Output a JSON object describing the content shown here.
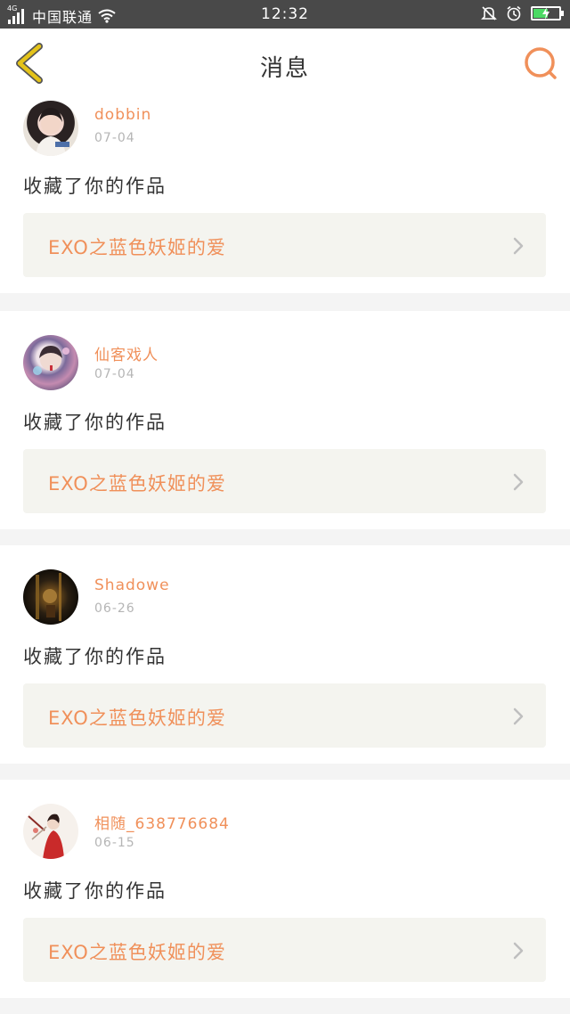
{
  "status_bar": {
    "network": "4G",
    "carrier": "中国联通",
    "time": "12:32"
  },
  "header": {
    "title": "消息"
  },
  "colors": {
    "accent": "#f0905a",
    "back_icon": "#e4c31a",
    "background": "#f4f4f4"
  },
  "messages": [
    {
      "username": "dobbin",
      "date": "07-04",
      "action": "收藏了你的作品",
      "work_title": "EXO之蓝色妖姬的爱"
    },
    {
      "username": "仙客戏人",
      "date": "07-04",
      "action": "收藏了你的作品",
      "work_title": "EXO之蓝色妖姬的爱"
    },
    {
      "username": "Shadowe",
      "date": "06-26",
      "action": "收藏了你的作品",
      "work_title": "EXO之蓝色妖姬的爱"
    },
    {
      "username": "相随_638776684",
      "date": "06-15",
      "action": "收藏了你的作品",
      "work_title": "EXO之蓝色妖姬的爱"
    }
  ]
}
